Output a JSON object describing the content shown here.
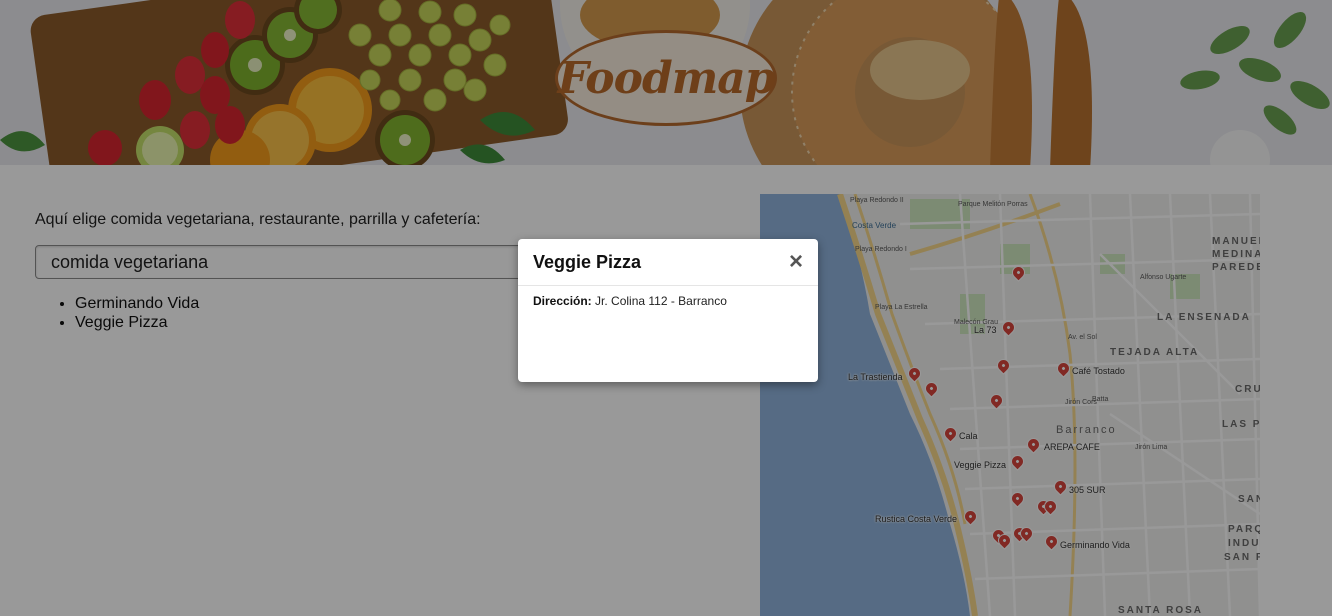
{
  "header": {
    "logo_text": "Foodmap"
  },
  "search": {
    "prompt": "Aquí elige comida vegetariana, restaurante, parrilla y cafetería:",
    "selected": "comida vegetariana",
    "results": [
      "Germinando Vida",
      "Veggie Pizza"
    ]
  },
  "map": {
    "areas": [
      "MANUEL",
      "MEDINA",
      "PAREDES",
      "LA ENSENADA",
      "TEJADA ALTA",
      "CRU",
      "LAS PA",
      "Barranco",
      "SAN",
      "PARQUE",
      "INDUS",
      "SAN PE",
      "SANTA ROSA"
    ],
    "beaches": [
      "Playa Redondo II",
      "Playa Redondo I",
      "Playa La Estrella",
      "Costa Verde",
      "Parque Melitón Porras"
    ],
    "streets": [
      "Av. el Sol",
      "Jirón Cors",
      "Batta",
      "Alfonso Ugarte",
      "Jirón Lima",
      "Malecón Grau"
    ],
    "places": [
      "La 73",
      "Café Tostado",
      "La Trastienda",
      "Cala",
      "AREPA CAFE",
      "Veggie Pizza",
      "305 SUR",
      "Rustica Costa Verde",
      "Germinando Vida"
    ]
  },
  "modal": {
    "title": "Veggie Pizza",
    "close_icon": "×",
    "address_label": "Dirección:",
    "address_value": "Jr. Colina 112 - Barranco"
  }
}
